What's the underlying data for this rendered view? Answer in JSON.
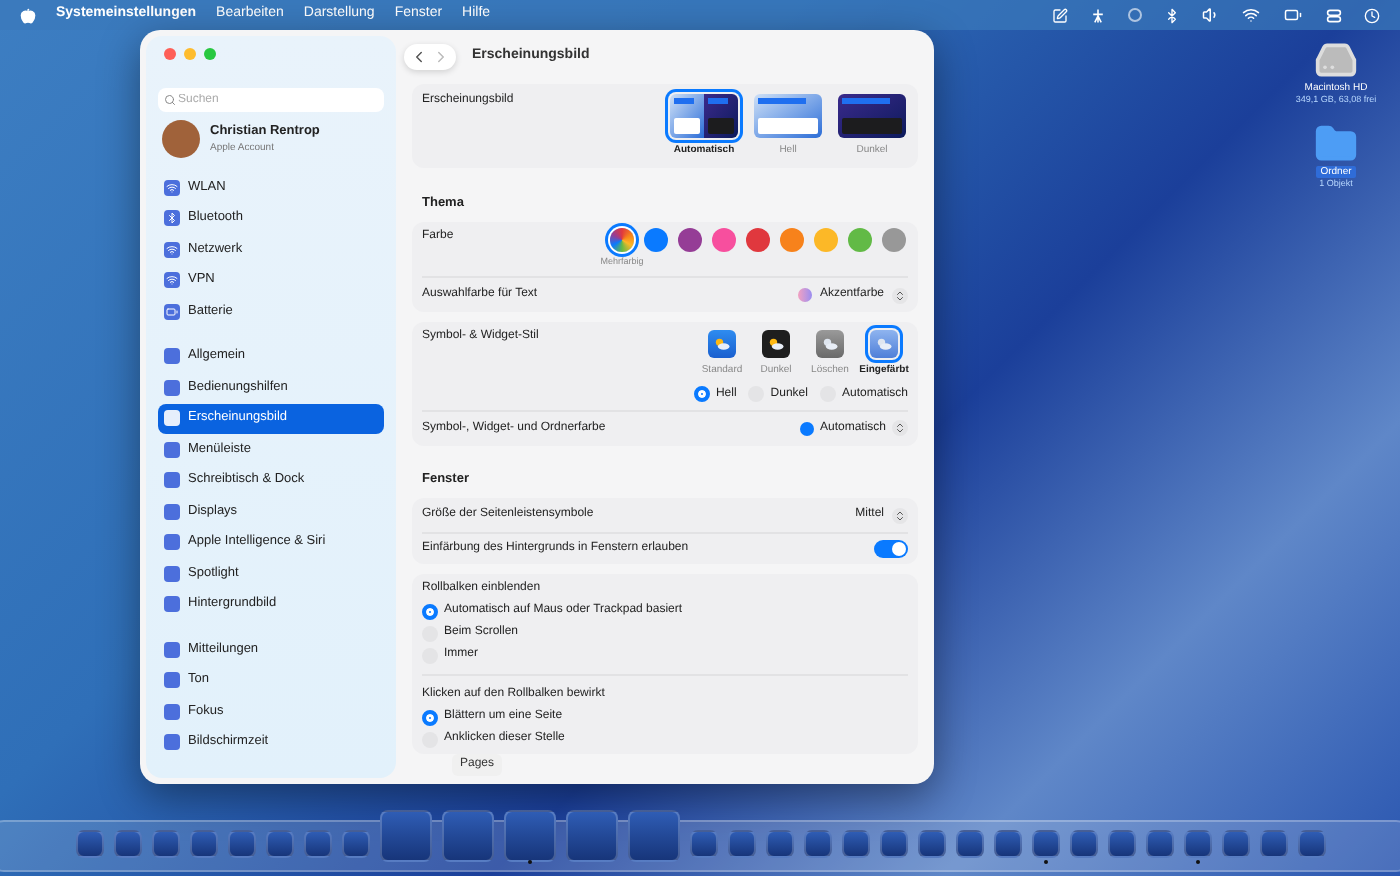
{
  "menu_bar": {
    "app_name": "Systemeinstellungen",
    "menus": [
      "Bearbeiten",
      "Darstellung",
      "Fenster",
      "Hilfe"
    ]
  },
  "desktop_icons": [
    {
      "kind": "drive",
      "label": "Macintosh HD",
      "detail": "349,1 GB, 63,08 frei",
      "selected": false
    },
    {
      "kind": "folder",
      "label": "Ordner",
      "detail": "1 Objekt",
      "selected": true
    }
  ],
  "sidebar": {
    "search": {
      "placeholder": "Suchen"
    },
    "account": {
      "name": "Christian Rentrop",
      "subtitle": "Apple Account"
    },
    "groups": [
      [
        {
          "label": "WLAN",
          "selected": false
        },
        {
          "label": "Bluetooth",
          "selected": false
        },
        {
          "label": "Netzwerk",
          "selected": false
        },
        {
          "label": "VPN",
          "selected": false
        },
        {
          "label": "Batterie",
          "selected": false
        }
      ],
      [
        {
          "label": "Allgemein",
          "selected": false
        },
        {
          "label": "Bedienungshilfen",
          "selected": false
        },
        {
          "label": "Erscheinungsbild",
          "selected": true
        },
        {
          "label": "Menüleiste",
          "selected": false
        },
        {
          "label": "Schreibtisch & Dock",
          "selected": false
        },
        {
          "label": "Displays",
          "selected": false
        },
        {
          "label": "Apple Intelligence & Siri",
          "selected": false
        },
        {
          "label": "Spotlight",
          "selected": false
        },
        {
          "label": "Hintergrundbild",
          "selected": false
        }
      ],
      [
        {
          "label": "Mitteilungen",
          "selected": false
        },
        {
          "label": "Ton",
          "selected": false
        },
        {
          "label": "Fokus",
          "selected": false
        },
        {
          "label": "Bildschirmzeit",
          "selected": false
        }
      ]
    ]
  },
  "content": {
    "title": "Erscheinungsbild",
    "appearance": {
      "label": "Erscheinungsbild",
      "options": [
        {
          "kind": "auto",
          "label": "Automatisch",
          "selected": true
        },
        {
          "kind": "light",
          "label": "Hell",
          "selected": false
        },
        {
          "kind": "dark",
          "label": "Dunkel",
          "selected": false
        }
      ]
    },
    "theme": {
      "heading": "Thema",
      "color_label": "Farbe",
      "colors": [
        {
          "kind": "multicolor",
          "label": "Mehrfarbig",
          "selected": true
        },
        {
          "kind": "solid",
          "color": "#0a7aff",
          "selected": false
        },
        {
          "kind": "solid",
          "color": "#953d96",
          "selected": false
        },
        {
          "kind": "solid",
          "color": "#f74f9e",
          "selected": false
        },
        {
          "kind": "solid",
          "color": "#e0383e",
          "selected": false
        },
        {
          "kind": "solid",
          "color": "#f7821b",
          "selected": false
        },
        {
          "kind": "solid",
          "color": "#fcb827",
          "selected": false
        },
        {
          "kind": "solid",
          "color": "#62ba46",
          "selected": false
        },
        {
          "kind": "solid",
          "color": "#989898",
          "selected": false
        }
      ],
      "highlight": {
        "label": "Auswahlfarbe für Text",
        "value": "Akzentfarbe"
      }
    },
    "widget_style": {
      "label": "Symbol- & Widget-Stil",
      "options": [
        {
          "kind": "standard",
          "label": "Standard",
          "selected": false
        },
        {
          "kind": "dark",
          "label": "Dunkel",
          "selected": false
        },
        {
          "kind": "clear",
          "label": "Löschen",
          "selected": false
        },
        {
          "kind": "tinted",
          "label": "Eingefärbt",
          "selected": true
        }
      ],
      "modes": [
        {
          "label": "Hell",
          "selected": true
        },
        {
          "label": "Dunkel",
          "selected": false
        },
        {
          "label": "Automatisch",
          "selected": false
        }
      ],
      "folder_color": {
        "label": "Symbol-, Widget- und Ordnerfarbe",
        "value": "Automatisch"
      }
    },
    "window_section": {
      "heading": "Fenster",
      "sidebar_icon_size": {
        "label": "Größe der Seitenleistensymbole",
        "value": "Mittel"
      },
      "wallpaper_tinting": {
        "label": "Einfärbung des Hintergrunds in Fenstern erlauben",
        "on": true
      }
    },
    "scrollbars": {
      "label": "Rollbalken einblenden",
      "options": [
        {
          "label": "Automatisch auf Maus oder Trackpad basiert",
          "selected": true
        },
        {
          "label": "Beim Scrollen",
          "selected": false
        },
        {
          "label": "Immer",
          "selected": false
        }
      ]
    },
    "scrollbar_click": {
      "label": "Klicken auf den Rollbalken bewirkt",
      "options": [
        {
          "label": "Blättern um eine Seite",
          "selected": true
        },
        {
          "label": "Anklicken dieser Stelle",
          "selected": false
        }
      ]
    }
  },
  "dock": {
    "tooltip": "Pages",
    "items": [
      {
        "magnified": false,
        "running": false
      },
      {
        "magnified": false,
        "running": false
      },
      {
        "magnified": false,
        "running": false
      },
      {
        "magnified": false,
        "running": false
      },
      {
        "magnified": false,
        "running": false
      },
      {
        "magnified": false,
        "running": false
      },
      {
        "magnified": false,
        "running": false
      },
      {
        "magnified": false,
        "running": false
      },
      {
        "magnified": true,
        "running": false
      },
      {
        "magnified": true,
        "running": false
      },
      {
        "magnified": true,
        "running": true
      },
      {
        "magnified": true,
        "running": false
      },
      {
        "magnified": true,
        "running": false
      },
      {
        "magnified": false,
        "running": false
      },
      {
        "magnified": false,
        "running": false
      },
      {
        "magnified": false,
        "running": false
      },
      {
        "magnified": false,
        "running": false
      },
      {
        "magnified": false,
        "running": false
      },
      {
        "magnified": false,
        "running": false
      },
      {
        "magnified": false,
        "running": false
      },
      {
        "magnified": false,
        "running": false
      },
      {
        "magnified": false,
        "running": false
      },
      {
        "magnified": false,
        "running": true
      },
      {
        "magnified": false,
        "running": false
      },
      {
        "magnified": false,
        "running": false
      },
      {
        "magnified": false,
        "running": false
      },
      {
        "magnified": false,
        "running": true
      },
      {
        "magnified": false,
        "running": false
      },
      {
        "magnified": false,
        "running": false
      },
      {
        "magnified": false,
        "running": false
      }
    ]
  }
}
